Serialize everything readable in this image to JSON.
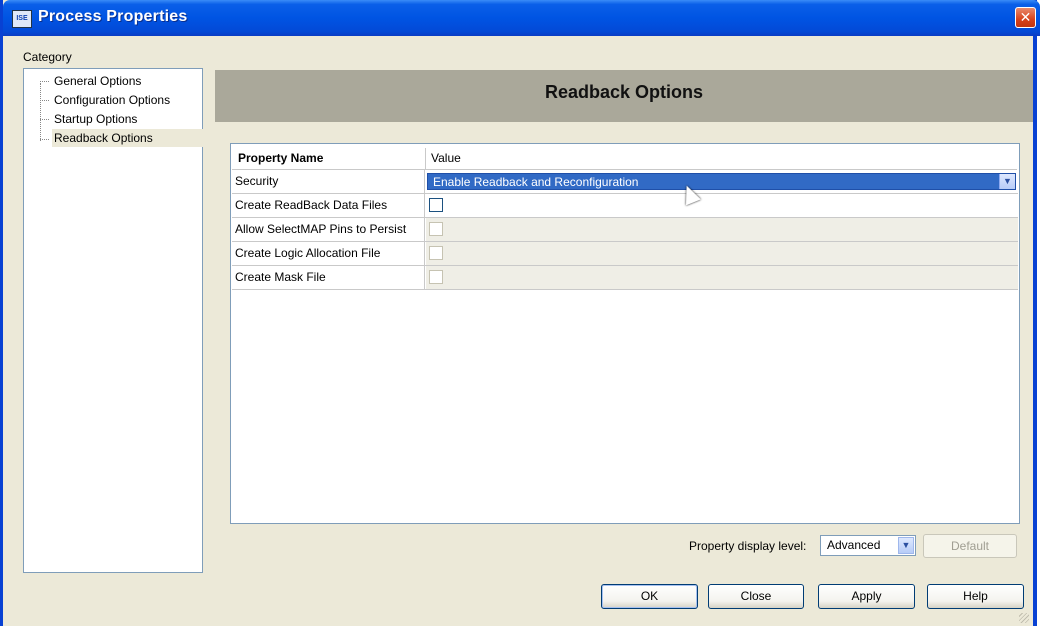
{
  "window": {
    "title": "Process Properties",
    "app_icon_label": "ISE",
    "close_glyph": "✕"
  },
  "category": {
    "label": "Category",
    "items": [
      {
        "label": "General Options"
      },
      {
        "label": "Configuration Options"
      },
      {
        "label": "Startup Options"
      },
      {
        "label": "Readback Options",
        "selected": true
      }
    ]
  },
  "panel": {
    "title": "Readback Options"
  },
  "grid": {
    "col_name": "Property Name",
    "col_value": "Value",
    "rows": [
      {
        "name": "Security",
        "value": "Enable Readback and Reconfiguration",
        "type": "combo"
      },
      {
        "name": "Create ReadBack Data Files",
        "value": "",
        "type": "checkbox",
        "checked": false,
        "enabled": true
      },
      {
        "name": "Allow SelectMAP Pins to Persist",
        "value": "",
        "type": "checkbox",
        "checked": false,
        "enabled": false
      },
      {
        "name": "Create Logic Allocation File",
        "value": "",
        "type": "checkbox",
        "checked": false,
        "enabled": false
      },
      {
        "name": "Create Mask File",
        "value": "",
        "type": "checkbox",
        "checked": false,
        "enabled": false
      }
    ]
  },
  "display_level": {
    "label": "Property display level:",
    "value": "Advanced",
    "default_button": "Default"
  },
  "buttons": {
    "ok": "OK",
    "close": "Close",
    "apply": "Apply",
    "help": "Help"
  },
  "icons": {
    "dropdown": "chevron-down-icon",
    "arrow_glyph": "▼"
  },
  "colors": {
    "title_bar": "#0054e3",
    "selection": "#316ac5",
    "header_band": "#aaa89a",
    "dialog_bg": "#ece9d8"
  }
}
